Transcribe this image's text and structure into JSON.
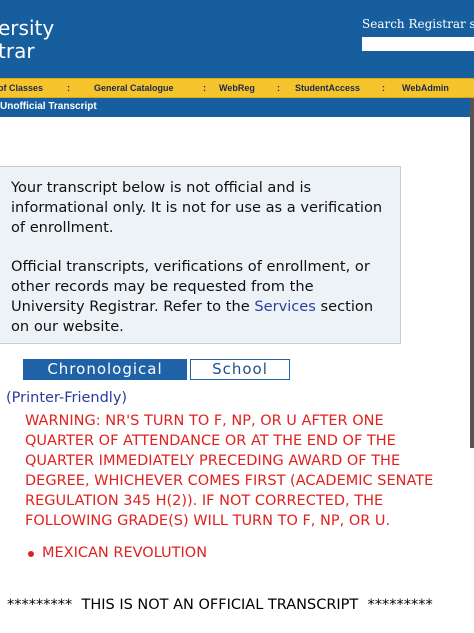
{
  "header": {
    "logo_lines": [
      "ersity",
      "trar"
    ],
    "search_label": "Search Registrar site:",
    "search_value": ""
  },
  "nav": {
    "items": [
      "of Classes",
      "General Catalogue",
      "WebReg",
      "StudentAccess",
      "WebAdmin"
    ],
    "separator": ":"
  },
  "subnav": {
    "title": "Unofficial Transcript"
  },
  "notice": {
    "p1": "Your transcript below is not official and is informational only. It is not for use as a verification of enrollment.",
    "p2_before": "Official transcripts, verifications of enrollment, or other records may be requested from the University Registrar. Refer to the ",
    "p2_link": "Services",
    "p2_after": " section on our website."
  },
  "tabs": {
    "active": "Chronological",
    "inactive": "School"
  },
  "printer_link": "(Printer-Friendly)",
  "warning_lines": [
    "WARNING: NR'S TURN TO F, NP, OR U AFTER ONE",
    "QUARTER OF ATTENDANCE OR AT THE END OF THE",
    "QUARTER IMMEDIATELY PRECEDING AWARD OF THE",
    "DEGREE, WHICHEVER COMES FIRST (ACADEMIC SENATE",
    "REGULATION 345 H(2)). IF NOT CORRECTED, THE",
    "FOLLOWING GRADE(S) WILL TURN TO F, NP, OR U."
  ],
  "courses": [
    "MEXICAN REVOLUTION"
  ],
  "footer": "*********  THIS IS NOT AN OFFICIAL TRANSCRIPT  *********",
  "colors": {
    "brand_blue": "#175e9e",
    "nav_gold": "#f5c42c",
    "warning_red": "#e0221e"
  }
}
